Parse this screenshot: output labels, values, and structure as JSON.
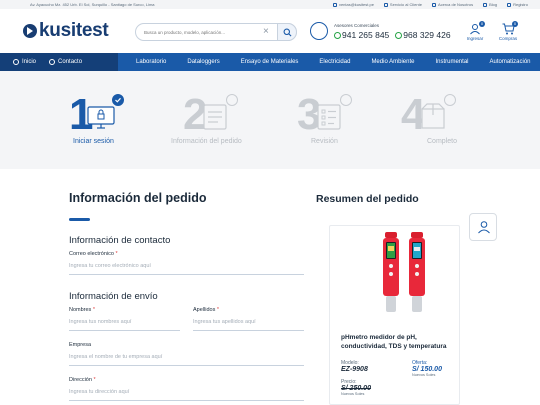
{
  "topbar": {
    "address": "Av. Ayacucho Mz. 452 Urb. El Sol, Surquillo - Santiago de Surco, Lima",
    "links": [
      "ventas@kusitest.pe",
      "Servicio al Cliente",
      "Acerca de Nosotros",
      "Blog",
      "Registro"
    ]
  },
  "header": {
    "logo": "kusitest",
    "search_placeholder": "Busca un producto, modelo, aplicación...",
    "advisors_label": "Asesores Comerciales",
    "phone1": "941 265 845",
    "phone2": "968 329 426",
    "login_label": "Ingresar",
    "cart_label": "Compras",
    "login_badge": "0",
    "cart_badge": "0"
  },
  "nav": {
    "home": "Inicio",
    "contact": "Contacto",
    "categories": [
      "Laboratorio",
      "Dataloggers",
      "Ensayo de Materiales",
      "Electricidad",
      "Medio Ambiente",
      "Instrumental",
      "Automatización"
    ]
  },
  "steps": [
    {
      "num": "1",
      "label": "Iniciar sesión",
      "active": true
    },
    {
      "num": "2",
      "label": "Información del pedido",
      "active": false
    },
    {
      "num": "3",
      "label": "Revisión",
      "active": false
    },
    {
      "num": "4",
      "label": "Completo",
      "active": false
    }
  ],
  "order": {
    "title": "Información del pedido",
    "contact_title": "Información de contacto",
    "email_label": "Correo electrónico",
    "email_placeholder": "Ingresa tu correo electrónico aquí",
    "shipping_title": "Información de envío",
    "names_label": "Nombres",
    "names_placeholder": "Ingresa tus nombres aquí",
    "surnames_label": "Apellidos",
    "surnames_placeholder": "Ingresa tus apellidos aquí",
    "company_label": "Empresa",
    "company_placeholder": "Ingresa el nombre de tu empresa aquí",
    "address_label": "Dirección",
    "address_placeholder": "Ingresa tu dirección aquí",
    "required_mark": "*"
  },
  "summary": {
    "title": "Resumen del pedido",
    "product_name": "pHmetro medidor de pH, conductividad, TDS y temperatura",
    "model_label": "Modelo:",
    "model": "EZ-9908",
    "offer_label": "Oferta:",
    "offer_price": "S/ 150.00",
    "offer_note": "Nuevos Soles",
    "price_label": "Precio:",
    "price": "S/ 250.00",
    "price_note": "Nuevos Soles"
  },
  "colors": {
    "brand": "#1a5aa8",
    "nav_dark": "#143f78",
    "step_inactive": "#c9cdd2"
  }
}
